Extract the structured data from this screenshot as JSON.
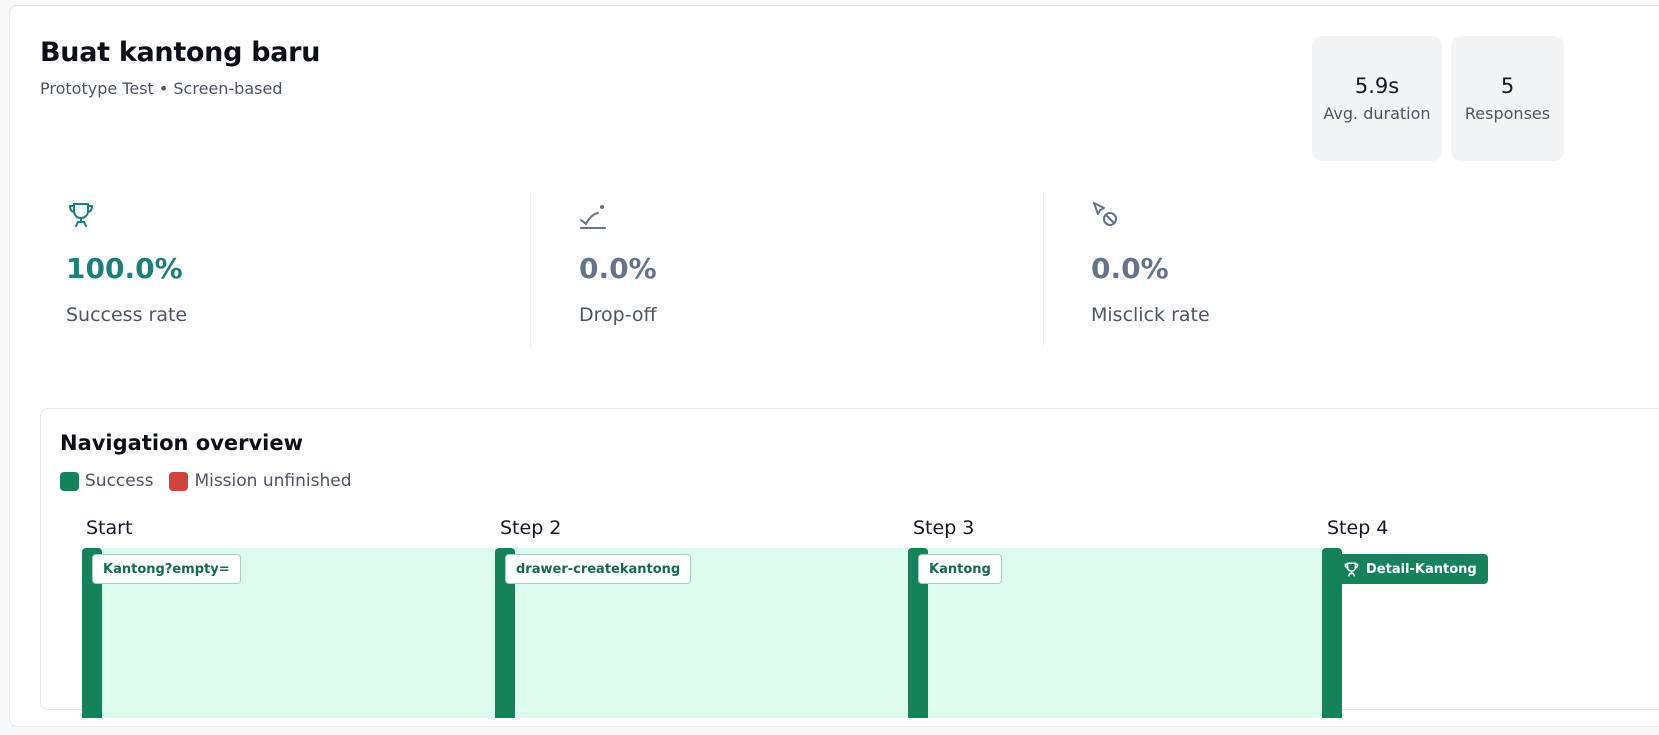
{
  "header": {
    "title": "Buat kantong baru",
    "subtitle": "Prototype Test • Screen-based"
  },
  "stats": [
    {
      "value": "5.9s",
      "label": "Avg. duration"
    },
    {
      "value": "5",
      "label": "Responses"
    }
  ],
  "metrics": [
    {
      "icon": "trophy-icon",
      "value": "100.0%",
      "label": "Success rate",
      "color": "#1e7f7a"
    },
    {
      "icon": "drop-off-icon",
      "value": "0.0%",
      "label": "Drop-off",
      "color": "#64748b"
    },
    {
      "icon": "misclick-icon",
      "value": "0.0%",
      "label": "Misclick rate",
      "color": "#64748b"
    }
  ],
  "navigation": {
    "title": "Navigation overview",
    "legend": [
      {
        "label": "Success",
        "color": "#16825a"
      },
      {
        "label": "Mission unfinished",
        "color": "#d0433b"
      }
    ],
    "steps": [
      {
        "label": "Start",
        "screen": "Kantong?empty="
      },
      {
        "label": "Step 2",
        "screen": "drawer-createkantong"
      },
      {
        "label": "Step 3",
        "screen": "Kantong"
      },
      {
        "label": "Step 4",
        "screen": "Detail-Kantong",
        "final_icon": "trophy-icon"
      }
    ]
  },
  "colors": {
    "success": "#16825a",
    "success_band": "#dcfaee",
    "success_rate_text": "#1e7f7a",
    "unfinished": "#d0433b"
  }
}
